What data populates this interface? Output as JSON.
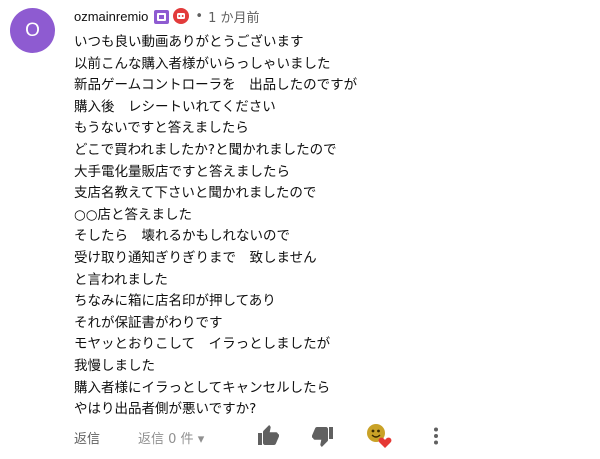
{
  "comment": {
    "avatar_letter": "O",
    "author": "ozmainremio",
    "dot": "•",
    "timestamp": "1 か月前",
    "lines": [
      "いつも良い動画ありがとうございます",
      "以前こんな購入者様がいらっしゃいました",
      "新品ゲームコントローラを　出品したのですが",
      "購入後　レシートいれてください",
      "もうないですと答えましたら",
      "どこで買われましたか?と聞かれましたので",
      "大手電化量販店ですと答えましたら",
      "支店名教えて下さいと聞かれましたので",
      "○○店と答えました",
      "そしたら　壊れるかもしれないので",
      "受け取り通知ぎりぎりまで　致しません",
      "と言われました",
      "ちなみに箱に店名印が押してあり",
      "それが保証書がわりです",
      "モヤッとおりこして　イラっとしましたが",
      "我慢しました",
      "購入者様にイラっとしてキャンセルしたら",
      "やはり出品者側が悪いですか?"
    ]
  },
  "actions": {
    "reply_label": "返信",
    "reply_count_label": "返信 0 件",
    "reply_count_arrow": "▾"
  },
  "colors": {
    "avatar_bg": "#8e5bd1",
    "member_badge": "#8e5bd1",
    "creator_badge": "#e23b3b",
    "secondary_text": "#606060",
    "icon": "#606060",
    "heart": "#e53935"
  },
  "icons": {
    "member_badge": "member-badge-icon",
    "creator_badge": "creator-badge-icon",
    "like": "thumbs-up-icon",
    "dislike": "thumbs-down-icon",
    "creator_heart": "creator-heart-icon",
    "more": "more-vertical-icon"
  }
}
